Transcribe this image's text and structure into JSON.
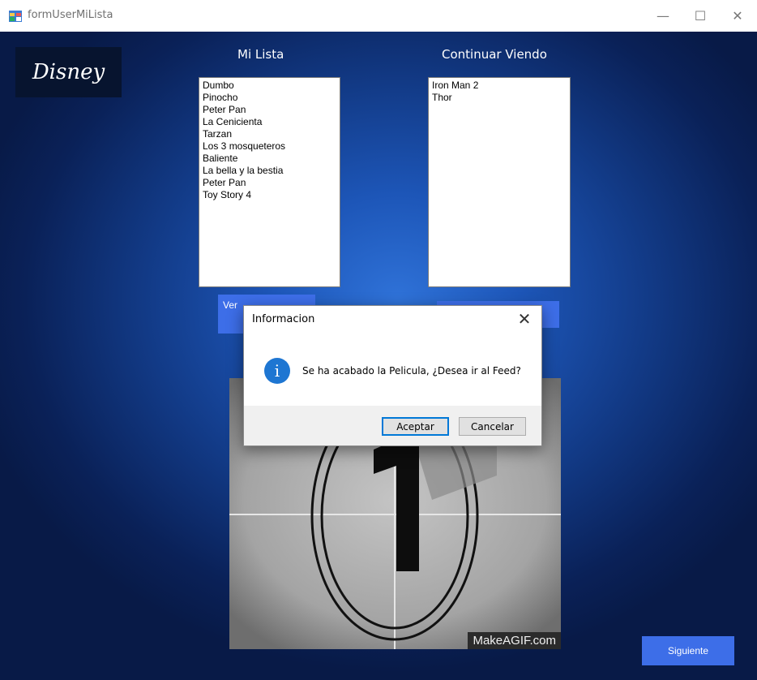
{
  "window": {
    "title": "formUserMiLista",
    "minimize_glyph": "—",
    "maximize_glyph": "☐",
    "close_glyph": "✕"
  },
  "logo": {
    "text": "Disney"
  },
  "mi_lista": {
    "heading": "Mi Lista",
    "items": [
      "Dumbo",
      "Pinocho",
      "Peter Pan",
      "La Cenicienta",
      "Tarzan",
      "Los 3 mosqueteros",
      "Baliente",
      "La bella y la bestia",
      "Peter Pan",
      "Toy Story 4"
    ],
    "button_label": "Ver"
  },
  "continuar_viendo": {
    "heading": "Continuar Viendo",
    "items": [
      "Iron Man 2",
      "Thor"
    ]
  },
  "preview": {
    "watermark": "MakeAGIF.com"
  },
  "footer": {
    "next_label": "Siguiente"
  },
  "dialog": {
    "title": "Informacion",
    "close_glyph": "✕",
    "info_glyph": "i",
    "message": "Se ha acabado la Pelicula, ¿Desea ir al Feed?",
    "accept_label": "Aceptar",
    "cancel_label": "Cancelar"
  },
  "colors": {
    "accent_button": "#3d6ee8",
    "info_icon": "#1e76d2",
    "background_center": "#2f72d8",
    "background_edge": "#081a47"
  },
  "icons": {
    "app": "app-window-icon",
    "dialog": "info-icon"
  }
}
